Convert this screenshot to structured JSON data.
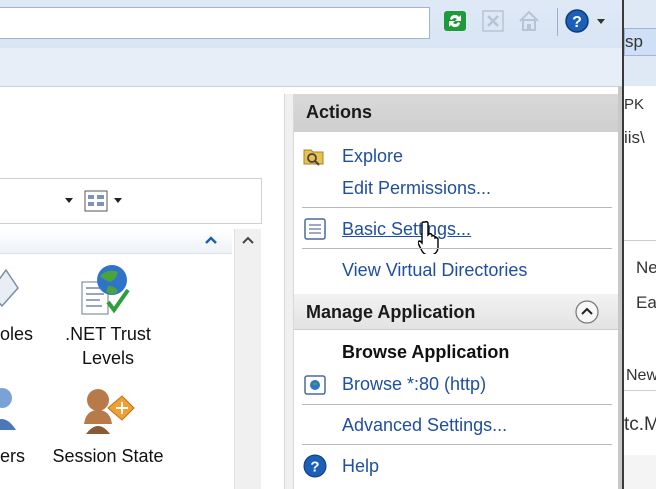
{
  "background_window": {
    "lines": [
      "sp",
      "PK",
      "iis\\",
      "Ne",
      "Ea",
      "New",
      "tc.M"
    ]
  },
  "features": [
    {
      "label_line1": "oles",
      "label_line2": ""
    },
    {
      "label_line1": ".NET Trust",
      "label_line2": "Levels"
    },
    {
      "label_line1": "ers",
      "label_line2": ""
    },
    {
      "label_line1": "Session State",
      "label_line2": ""
    }
  ],
  "actions": {
    "header": "Actions",
    "explore": "Explore",
    "edit_permissions": "Edit Permissions...",
    "basic_settings": "Basic Settings...",
    "view_virtual_directories": "View Virtual Directories",
    "manage_application": {
      "header": "Manage Application",
      "browse_application": "Browse Application",
      "browse_port": "Browse *:80 (http)",
      "advanced_settings": "Advanced Settings..."
    },
    "help": "Help"
  },
  "colors": {
    "link": "#1f4fa0",
    "accent": "#1c5fb8"
  },
  "icons": [
    "refresh-icon",
    "stop-icon",
    "home-icon",
    "help-icon",
    "explore-folder-icon",
    "basic-settings-icon",
    "browse-globe-icon",
    "collapse-chevron-icon",
    "view-toggle-icon"
  ]
}
